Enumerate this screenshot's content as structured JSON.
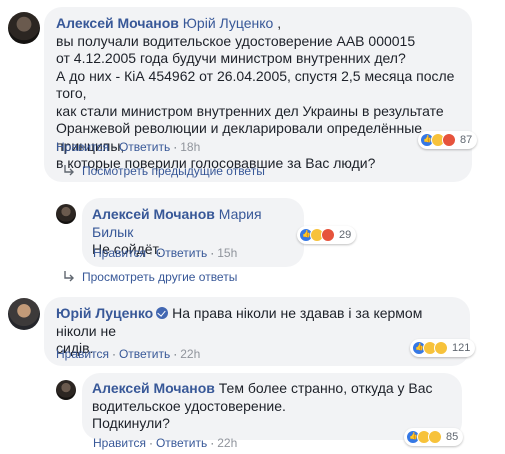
{
  "comments": [
    {
      "author": "Алексей Мочанов",
      "mention": "Юрій Луценко",
      "mention_suffix": " ,",
      "lines": [
        "вы получали водительское удостоверение ААВ 000015",
        "от 4.12.2005 года будучи министром внутренних дел?",
        "А до них - КіА 454962 от 26.04.2005, спустя 2,5 месяца после того,",
        "как стали министром внутренних дел Украины в результате",
        "Оранжевой революции и декларировали определённые принципы,",
        "в которые поверили голосовавшие за Вас люди?"
      ],
      "like_label": "Нравится",
      "reply_label": "Ответить",
      "time": "18h",
      "reaction_count": "87",
      "reaction_icons": [
        "like-icon",
        "haha-icon",
        "angry-icon"
      ]
    },
    {
      "author": "Алексей Мочанов",
      "mention": "Мария Билык",
      "lines": [
        "Не сойдёт."
      ],
      "like_label": "Нравится",
      "reply_label": "Ответить",
      "time": "15h",
      "reaction_count": "29",
      "reaction_icons": [
        "like-icon",
        "haha-icon",
        "angry-icon"
      ]
    },
    {
      "author": "Юрій Луценко",
      "lines": [
        "На права ніколи не здавав і за кермом ніколи не",
        "сидів."
      ],
      "like_label": "Нравится",
      "reply_label": "Ответить",
      "time": "22h",
      "reaction_count": "121",
      "reaction_icons": [
        "like-icon",
        "haha-icon",
        "wow-icon"
      ]
    },
    {
      "author": "Алексей Мочанов",
      "lines": [
        "Тем более странно, откуда у Вас",
        "водительское удостоверение.",
        "Подкинули?"
      ],
      "like_label": "Нравится",
      "reply_label": "Ответить",
      "time": "22h",
      "reaction_count": "85",
      "reaction_icons": [
        "like-icon",
        "haha-icon",
        "wow-icon"
      ]
    }
  ],
  "links": {
    "previous_replies": "Посмотреть предыдущие ответы",
    "other_replies": "Просмотреть другие ответы"
  },
  "colors": {
    "link_blue": "#385898",
    "bubble_bg": "#f2f3f5",
    "meta_gray": "#90949c"
  }
}
